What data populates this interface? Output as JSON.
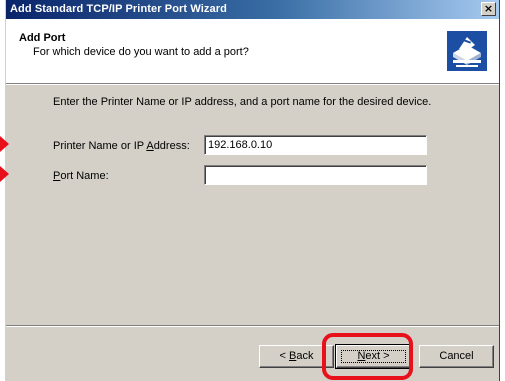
{
  "window": {
    "title": "Add Standard TCP/IP Printer Port Wizard",
    "close_glyph": "×"
  },
  "header": {
    "title": "Add Port",
    "subtitle": "For which device do you want to add a port?",
    "icon": "printer-port-icon"
  },
  "main": {
    "instruction": "Enter the Printer Name or IP address, and a port name for the desired device.",
    "fields": [
      {
        "label_pre": "Printer Name or IP ",
        "label_accel": "A",
        "label_post": "ddress:",
        "value": "192.168.0.10"
      },
      {
        "label_pre": "",
        "label_accel": "P",
        "label_post": "ort Name:",
        "value": ""
      }
    ]
  },
  "footer": {
    "back_label_pre": "< ",
    "back_accel": "B",
    "back_post": "ack",
    "next_accel": "N",
    "next_post": "ext >",
    "cancel_label": "Cancel"
  },
  "annotations": {
    "arrow_color": "#e8101a",
    "highlight_color": "#e8101a"
  }
}
